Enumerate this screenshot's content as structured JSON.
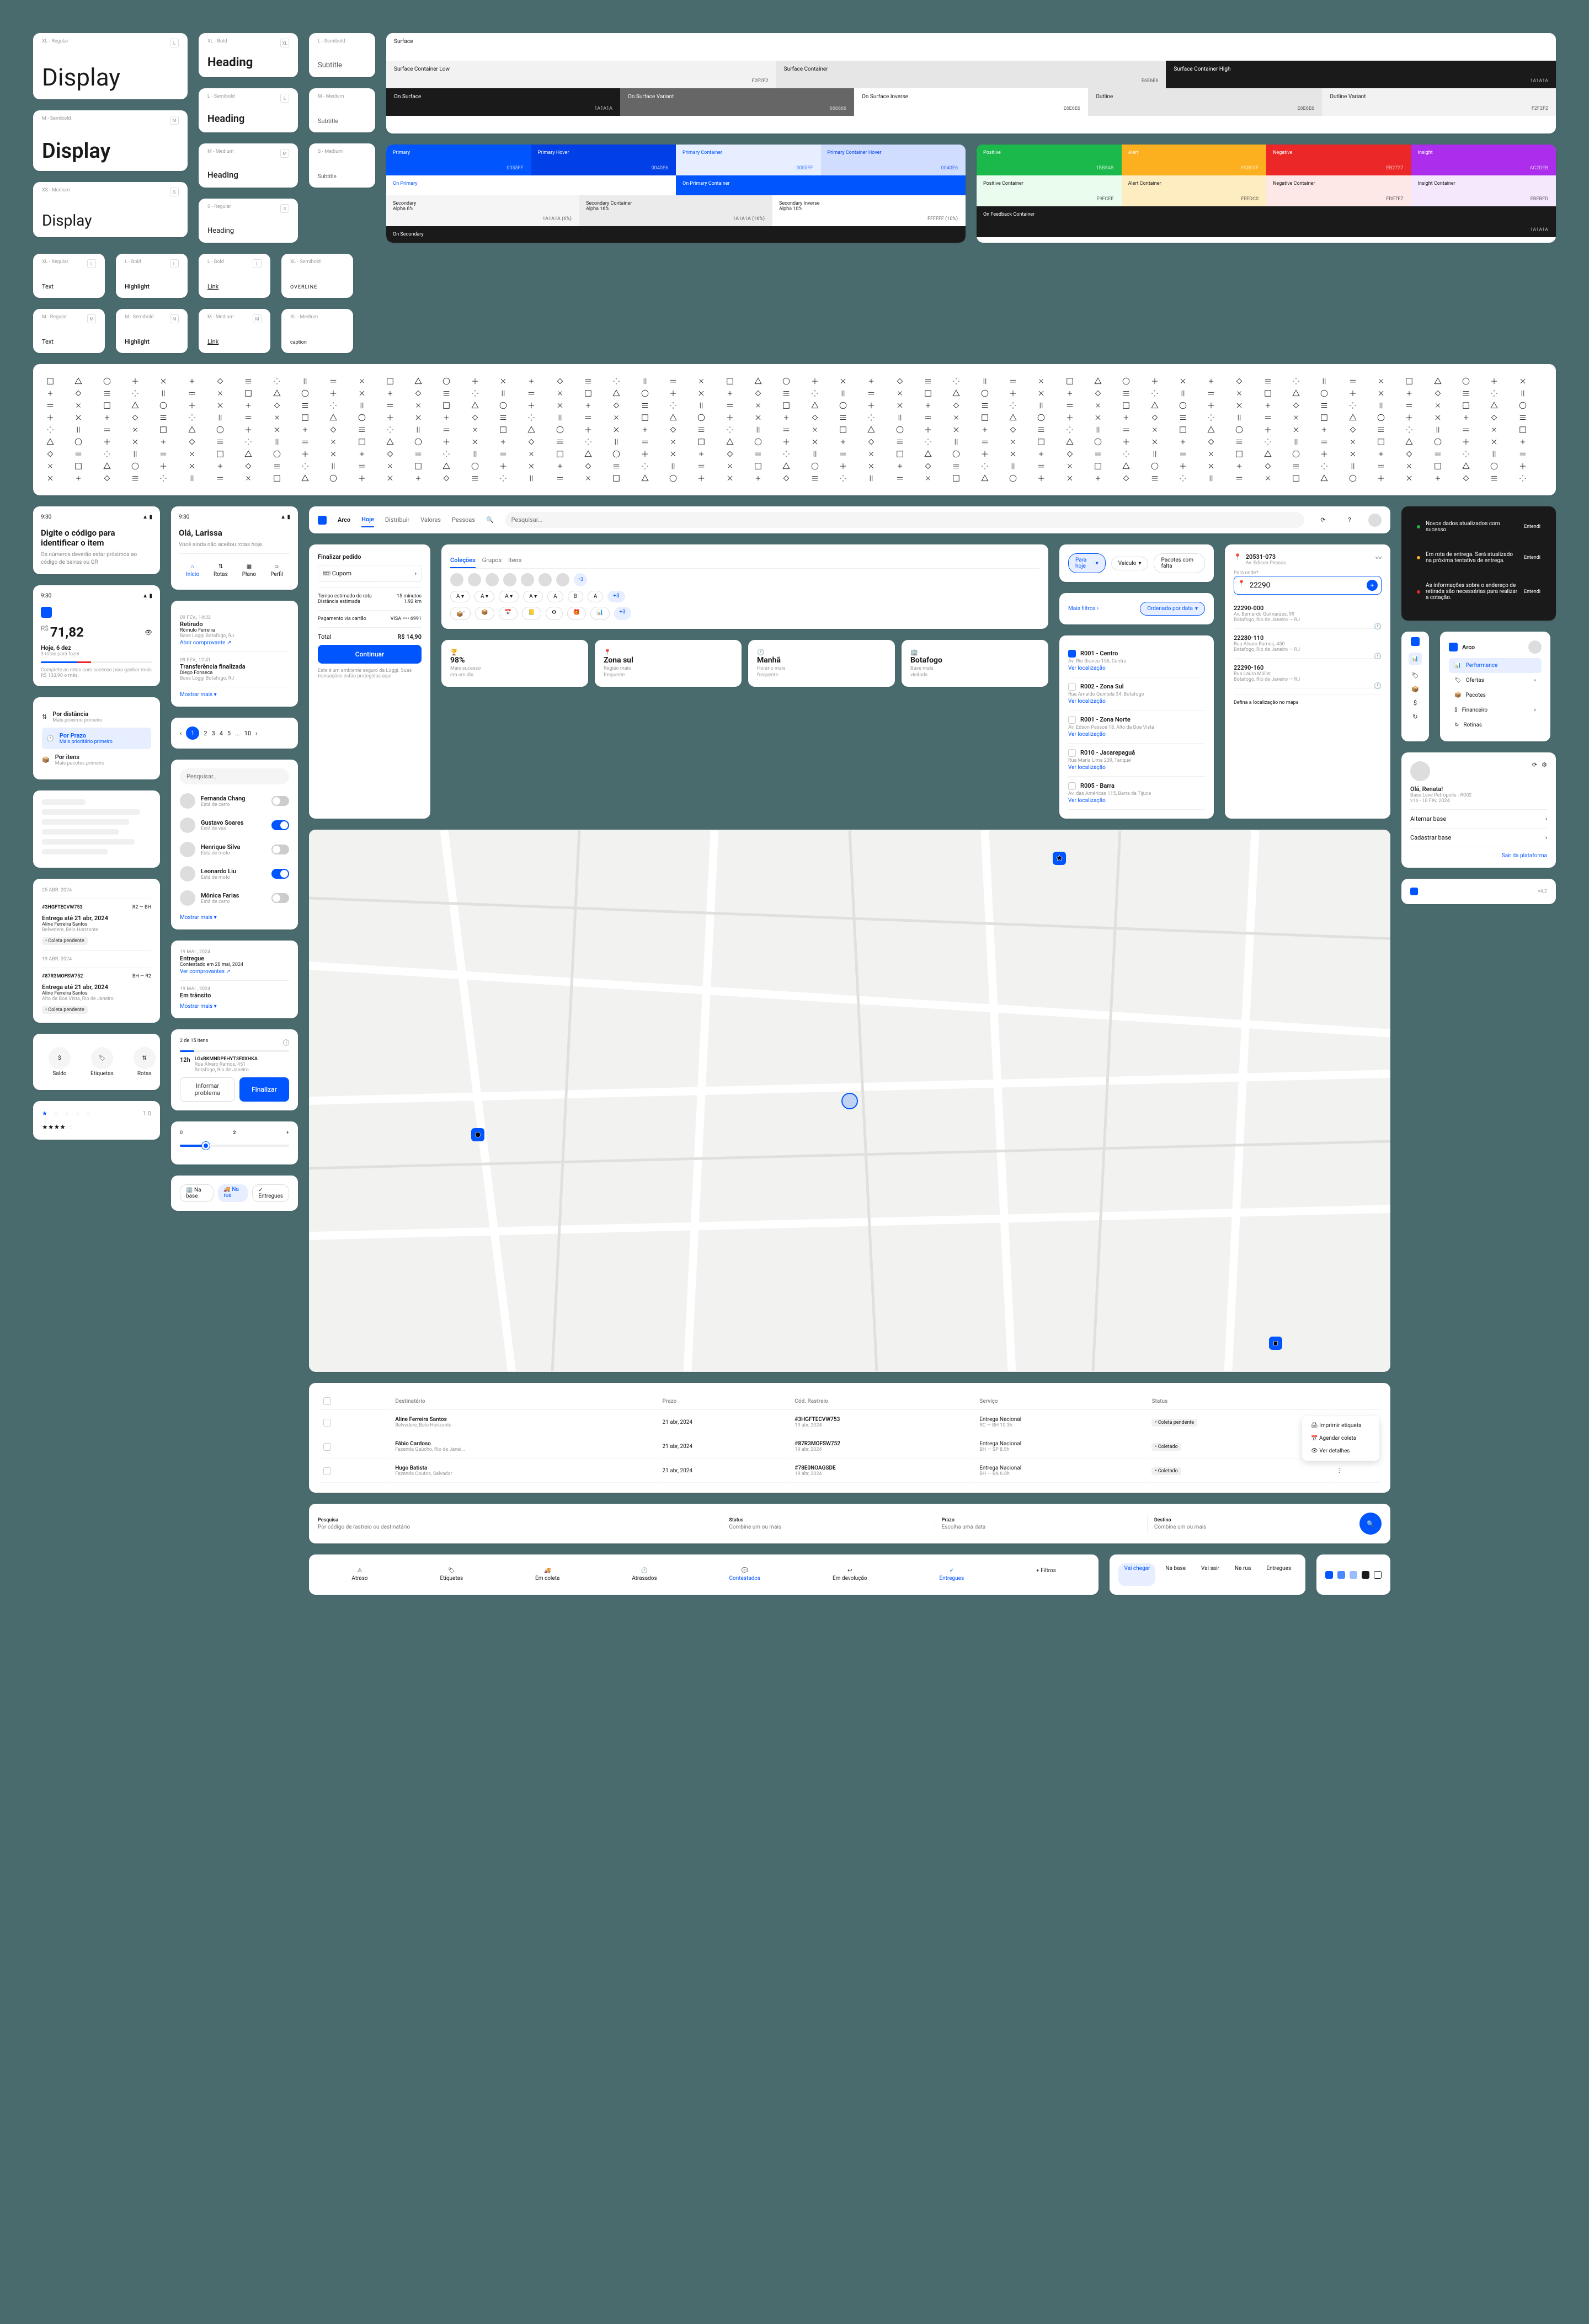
{
  "typography": {
    "display_l": {
      "label": "XL - Regular",
      "text": "Display",
      "badge": "L"
    },
    "display_m": {
      "label": "M - Semibold",
      "text": "Display",
      "badge": "M"
    },
    "display_s": {
      "label": "XS - Medium",
      "text": "Display",
      "badge": "S"
    },
    "heading_xl": {
      "label": "XL - Bold",
      "text": "Heading",
      "badge": "XL"
    },
    "heading_l": {
      "label": "L - Semibold",
      "text": "Heading",
      "badge": "L"
    },
    "heading_m": {
      "label": "M - Medium",
      "text": "Heading",
      "badge": "M"
    },
    "heading_s": {
      "label": "S - Regular",
      "text": "Heading",
      "badge": "S"
    },
    "subtitle_l": {
      "label": "L - Semibold",
      "text": "Subtitle",
      "badge": "L"
    },
    "subtitle_m": {
      "label": "M - Medium",
      "text": "Subtitle",
      "badge": "M"
    },
    "subtitle_s": {
      "label": "S - Medium",
      "text": "Subtitle",
      "badge": "S"
    },
    "text_l": {
      "label": "XL - Regular",
      "text": "Text",
      "badge": "L"
    },
    "text_m": {
      "label": "M - Regular",
      "text": "Text",
      "badge": "M"
    },
    "highlight_l": {
      "label": "L - Bold",
      "text": "Highlight",
      "badge": "L"
    },
    "highlight_m": {
      "label": "M - Semibold",
      "text": "Highlight",
      "badge": "M"
    },
    "link_l": {
      "label": "L - Bold",
      "text": "Link",
      "badge": "L"
    },
    "link_m": {
      "label": "M - Medium",
      "text": "Link",
      "badge": "M"
    },
    "overline": {
      "label": "XL - Semibold",
      "text": "OVERLINE"
    },
    "caption": {
      "label": "XL - Medium",
      "text": "caption"
    }
  },
  "surfaces": {
    "title": "Surface",
    "low": {
      "name": "Surface Container Low",
      "hex": "F2F2F2"
    },
    "cont": {
      "name": "Surface Container",
      "hex": "E6E6E6"
    },
    "high": {
      "name": "Surface Container High",
      "hex": "1A1A1A"
    },
    "onsurf": {
      "name": "On Surface",
      "hex": "1A1A1A"
    },
    "onvar": {
      "name": "On Surface Variant",
      "hex": "666666"
    },
    "inv": {
      "name": "On Surface Inverse",
      "hex": "E6E6E6"
    },
    "outline": {
      "name": "Outline",
      "hex": "E6E6E6"
    },
    "outvar": {
      "name": "Outline Variant",
      "hex": "F2F2F2"
    }
  },
  "primary_colors": {
    "primary": {
      "name": "Primary",
      "hex": "0055FF"
    },
    "primary_h": {
      "name": "Primary Hover",
      "hex": "0040E6"
    },
    "primcont": {
      "name": "Primary Container",
      "hex": "0055FF"
    },
    "primcont_h": {
      "name": "Primary Container Hover",
      "hex": "0040E6"
    },
    "onprim": {
      "name": "On Primary",
      "hex": "FFFFFF"
    },
    "onprimcont": {
      "name": "On Primary Container",
      "hex": "FFFFFF"
    },
    "sec": {
      "name": "Secondary",
      "sub": "Alpha 6%",
      "hex": "1A1A1A (6%)"
    },
    "seccont": {
      "name": "Secondary Container",
      "sub": "Alpha 16%",
      "hex": "1A1A1A (16%)"
    },
    "secinv": {
      "name": "Secondary Inverse",
      "sub": "Alpha 10%",
      "hex": "FFFFFF (10%)"
    },
    "onsec": {
      "name": "On Secondary",
      "hex": "1A1A1A"
    }
  },
  "feedback_colors": {
    "pos": {
      "name": "Positive",
      "hex": "1BB84B"
    },
    "alert": {
      "name": "Alert",
      "hex": "FCB01F"
    },
    "neg": {
      "name": "Negative",
      "hex": "EB2727"
    },
    "insight": {
      "name": "Insight",
      "hex": "AC2DEB"
    },
    "poscont": {
      "name": "Positive Container",
      "hex": "E9FCEE"
    },
    "alertcont": {
      "name": "Alert Container",
      "hex": "FEEDC0"
    },
    "negcont": {
      "name": "Negative Container",
      "hex": "FDE7E7"
    },
    "inscont": {
      "name": "Insight Container",
      "hex": "EBEBFD"
    },
    "onfeed": {
      "name": "On Feedback Container",
      "hex": "1A1A1A"
    }
  },
  "mobile1": {
    "time": "9:30",
    "title": "Digite o código para identificar o item",
    "sub": "Os números deverão estar próximos ao código de barras ou QR"
  },
  "mobile2": {
    "time": "9:30",
    "greeting": "Olá, Larissa",
    "sub": "Você ainda não aceitou rotas hoje.",
    "tabs": [
      "Início",
      "Rotas",
      "Plano",
      "Perfil"
    ]
  },
  "mobile3": {
    "time": "9:30",
    "price_prefix": "R$",
    "price": "71,82",
    "today": "Hoje, 6 dez",
    "routes": "3 rotas para fazer",
    "footer": "Complete as rotas com sucesso para ganhar mais R$ 133,90 o mês."
  },
  "timeline": {
    "items": [
      {
        "date": "09 FEV., 14:32",
        "title": "Retirado",
        "person": "Rômulo Ferreira",
        "base": "Base Loggi Botafogo, RJ",
        "link": "Abrir comprovante"
      },
      {
        "date": "09 FEV., 12:41",
        "title": "Transferência finalizada",
        "person": "Diego Fonseca",
        "base": "Base Loggi Botafogo, RJ"
      }
    ],
    "more": "Mostrar mais"
  },
  "sort_options": {
    "title1": "Por distância",
    "sub1": "Mais próximo primeiro",
    "title2": "Por Prazo",
    "sub2": "Mais prioritário primeiro",
    "title3": "Por itens",
    "sub3": "Mais pacotes primeiro"
  },
  "checkout": {
    "title": "Finalizar pedido",
    "cupom": "Cupom",
    "est_time": "Tempo estimado de rota",
    "est_time_val": "15 minutos",
    "dist": "Distância estimada",
    "dist_val": "1.92 km",
    "payment": "Pagamento via cartão",
    "card": "VISA •••• 6991",
    "total": "Total",
    "total_val": "R$ 14,90",
    "btn": "Continuar",
    "footer": "Este é um ambiente seguro da Loggi. Suas transações estão protegidas aqui."
  },
  "collections": {
    "tabs": [
      "Coleções",
      "Grupos",
      "Itens"
    ],
    "plus": "+3",
    "letters": [
      "A",
      "A",
      "A",
      "A",
      "A",
      "B",
      "A",
      "+3"
    ],
    "plus2": "+3"
  },
  "app_nav": {
    "brand": "Arco",
    "items": [
      "Hoje",
      "Distribuir",
      "Valores",
      "Pessoas"
    ],
    "search_placeholder": "Pesquisar..."
  },
  "filter_bar": {
    "items": [
      "Para hoje",
      "Veículo",
      "Pacotes com falta",
      "Mais filtros"
    ],
    "sort": "Ordenado por data"
  },
  "routes_list": {
    "items": [
      {
        "code": "R001 - Centro",
        "addr": "Av. Rio Branco 156, Centro",
        "link": "Ver localização",
        "checked": true
      },
      {
        "code": "R002 - Zona Sul",
        "addr": "Rua Arnaldo Quintela 34, Botafogo",
        "link": "Ver localização"
      },
      {
        "code": "R001 - Zona Norte",
        "addr": "Av. Edson Passos 18, Alto da Boa Vista",
        "link": "Ver localização"
      },
      {
        "code": "R010 - Jacarepaguá",
        "addr": "Rua Maria Lima 239, Tanque",
        "link": "Ver localização"
      },
      {
        "code": "R005 - Barra",
        "addr": "Av. das Américas 115, Barra da Tijuca",
        "link": "Ver localização"
      }
    ]
  },
  "address_search": {
    "cep": "20531-073",
    "cep_addr": "Av. Edison Passos",
    "label": "Para onde?",
    "input": "22290",
    "results": [
      {
        "cep": "22290-000",
        "addr": "Av. Bernardo Guimarães, 99\nBotafogo, Rio de Janeiro — RJ"
      },
      {
        "cep": "22280-110",
        "addr": "Rua Álvaro Ramos, 450\nBotafogo, Rio de Janeiro — RJ"
      },
      {
        "cep": "22290-160",
        "addr": "Rua Lauro Müller\nBotafogo, Rio de Janeiro — RJ"
      }
    ],
    "map_link": "Defina a localização no mapa"
  },
  "stats": [
    {
      "val": "98%",
      "label": "Mais sucesso",
      "sub": "em um dia"
    },
    {
      "val": "Zona sul",
      "label": "Região mais",
      "sub": "frequente"
    },
    {
      "val": "Manhã",
      "label": "Horário mais",
      "sub": "frequente"
    },
    {
      "val": "Botafogo",
      "label": "Base mais",
      "sub": "visitada"
    }
  ],
  "people": {
    "search": "Pesquisar...",
    "items": [
      {
        "name": "Fernanda Chang",
        "sub": "Está de carro",
        "on": false
      },
      {
        "name": "Gustavo Soares",
        "sub": "Está de van",
        "on": true
      },
      {
        "name": "Henrique Silva",
        "sub": "Está de moto",
        "on": false
      },
      {
        "name": "Leonardo Liu",
        "sub": "Está de moto",
        "on": true
      },
      {
        "name": "Mônica Farias",
        "sub": "Está de carro",
        "on": false
      }
    ],
    "more": "Mostrar mais"
  },
  "toasts": [
    {
      "color": "green",
      "text": "Novos dados atualizados com sucesso.",
      "action": "Entendi"
    },
    {
      "color": "yellow",
      "text": "Em rota de entrega. Será atualizado na próxima tentativa de entrega.",
      "action": "Entendi"
    },
    {
      "color": "red",
      "text": "As informações sobre o endereço de retirada são necessárias para realizar a cotação.",
      "action": "Entendi"
    }
  ],
  "sidebar_app": {
    "brand": "Arco",
    "items": [
      {
        "icon": "chart",
        "label": "Performance",
        "active": true
      },
      {
        "icon": "tag",
        "label": "Ofertas",
        "chev": true
      },
      {
        "icon": "box",
        "label": "Pacotes"
      },
      {
        "icon": "dollar",
        "label": "Financeiro",
        "chev": true
      },
      {
        "icon": "clock",
        "label": "Rotinas"
      }
    ]
  },
  "deliveries": {
    "date1": "25 ABR. 2024",
    "item1": {
      "code": "#3HGFTECVW753",
      "route": "R2 — BH",
      "label": "Entrega até 21 abr, 2024",
      "name": "Aline Ferreira Santos",
      "addr": "Belvedere, Belo Horizonte",
      "tag": "• Coleta pendente"
    },
    "date2": "19 ABR. 2024",
    "item2": {
      "code": "#87R3MOFSW752",
      "route": "BH — R2",
      "label": "Entrega até 21 abr, 2024",
      "name": "Aline Ferreira Santos",
      "addr": "Alto da Boa Vista, Rio de Janeiro",
      "tag": "• Coleta pendente"
    }
  },
  "status_card": {
    "date": "19 MAI., 2024",
    "title": "Entregue",
    "sub": "Contestado em 20 mai, 2024",
    "link": "Ver comprovantes",
    "date2": "19 MAI., 2024",
    "title2": "Em trânsito",
    "more": "Mostrar mais"
  },
  "batch": {
    "count": "2 de 15 itens",
    "id": "LGxBKMNDPEHYT3E0XHKA",
    "num": "12h",
    "addr": "Rua Álvaro Ramos, 451\nBotafogo, Rio de Janeiro",
    "btn1": "Informar problema",
    "btn2": "Finalizar"
  },
  "bottom_tabs1": [
    "Saldo",
    "Etiquetas",
    "Rotas"
  ],
  "stars_val": "1.0",
  "segmented": [
    "Na base",
    "Na rua",
    "Entregues"
  ],
  "table": {
    "headers": [
      "Destinatário",
      "Prazo",
      "Cód. Rastreio",
      "Serviço",
      "Status"
    ],
    "rows": [
      {
        "name": "Aline Ferreira Santos",
        "addr": "Belvedere, Belo Horizonte",
        "date": "21 abr, 2024",
        "code": "#3HGFTECVW753",
        "code_sub": "19 abr, 2024",
        "service": "Entrega Nacional",
        "service_sub": "RC — BH 10.3h",
        "status": "• Coleta pendente"
      },
      {
        "name": "Fábio Cardoso",
        "addr": "Fazenda Gaúcho, Rio de Janei...",
        "date": "21 abr, 2024",
        "code": "#87R3MOFSW752",
        "code_sub": "19 abr, 2024",
        "service": "Entrega Nacional",
        "service_sub": "BH — SP 8.5h",
        "status": "• Coletado"
      },
      {
        "name": "Hugo Batista",
        "addr": "Fazenda Coutos, Salvador",
        "date": "21 abr, 2024",
        "code": "#78E0NOAGSDE",
        "code_sub": "19 abr, 2024",
        "service": "Entrega Nacional",
        "service_sub": "BH — BA 6.8h",
        "status": "• Coletado"
      }
    ],
    "menu": [
      "Imprimir etiqueta",
      "Agendar coleta",
      "Ver detalhes"
    ]
  },
  "profile": {
    "greeting": "Olá, Renata!",
    "base": "Base Leve Petrópolis - R002",
    "version": "v16 - 10 Fev, 2024",
    "alt": "Alternar base",
    "cad": "Cadastrar base",
    "exit": "Sair da plataforma"
  },
  "search_bar": {
    "label1": "Pesquisa",
    "ph1": "Por código de rastreio ou destinatário",
    "label2": "Status",
    "ph2": "Combine um ou mais",
    "label3": "Prazo",
    "ph3": "Escolha uma data",
    "label4": "Destino",
    "ph4": "Combine um ou mais"
  },
  "tabs_icons": [
    "Atraso",
    "Etiquetas",
    "Em coleta",
    "Atrasados",
    "Contestados",
    "Em devolução",
    "Entregues",
    "+ Filtros"
  ],
  "tabs_text": [
    "Vai chegar",
    "Na base",
    "Vai sair",
    "Na rua",
    "Entregues"
  ],
  "slider": {
    "min": "0",
    "val": "2",
    "max": "+"
  },
  "pagination": [
    "1",
    "2",
    "3",
    "4",
    "5",
    "...",
    "10"
  ],
  "footer_version": "v4.2"
}
